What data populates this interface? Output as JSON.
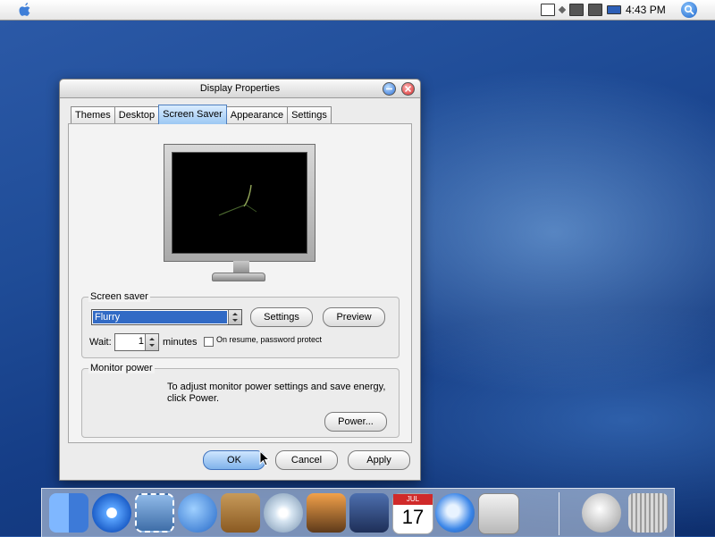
{
  "menubar": {
    "clock": "4:43 PM"
  },
  "window": {
    "title": "Display Properties",
    "tabs": [
      "Themes",
      "Desktop",
      "Screen Saver",
      "Appearance",
      "Settings"
    ],
    "active_tab": "Screen Saver",
    "screen_saver": {
      "group_label": "Screen saver",
      "selected": "Flurry",
      "settings_label": "Settings",
      "preview_label": "Preview",
      "wait_label": "Wait:",
      "wait_value": "1",
      "minutes_label": "minutes",
      "password_label": "On resume, password protect",
      "password_checked": false
    },
    "monitor_power": {
      "group_label": "Monitor power",
      "description": "To adjust monitor power settings and save energy, click Power.",
      "power_label": "Power..."
    },
    "buttons": {
      "ok": "OK",
      "cancel": "Cancel",
      "apply": "Apply"
    }
  },
  "dock": {
    "items": [
      "finder-icon",
      "safari-icon",
      "mail-icon",
      "ichat-icon",
      "address-book-icon",
      "itunes-icon",
      "iphoto-icon",
      "imovie-icon",
      "ical-icon",
      "quicktime-icon",
      "system-preferences-icon",
      "mail-spring-icon",
      "trash-icon"
    ],
    "ical_date": "17",
    "ical_month": "JUL"
  },
  "colors": {
    "accent": "#316ac5",
    "desktop": "#1f4c97"
  }
}
